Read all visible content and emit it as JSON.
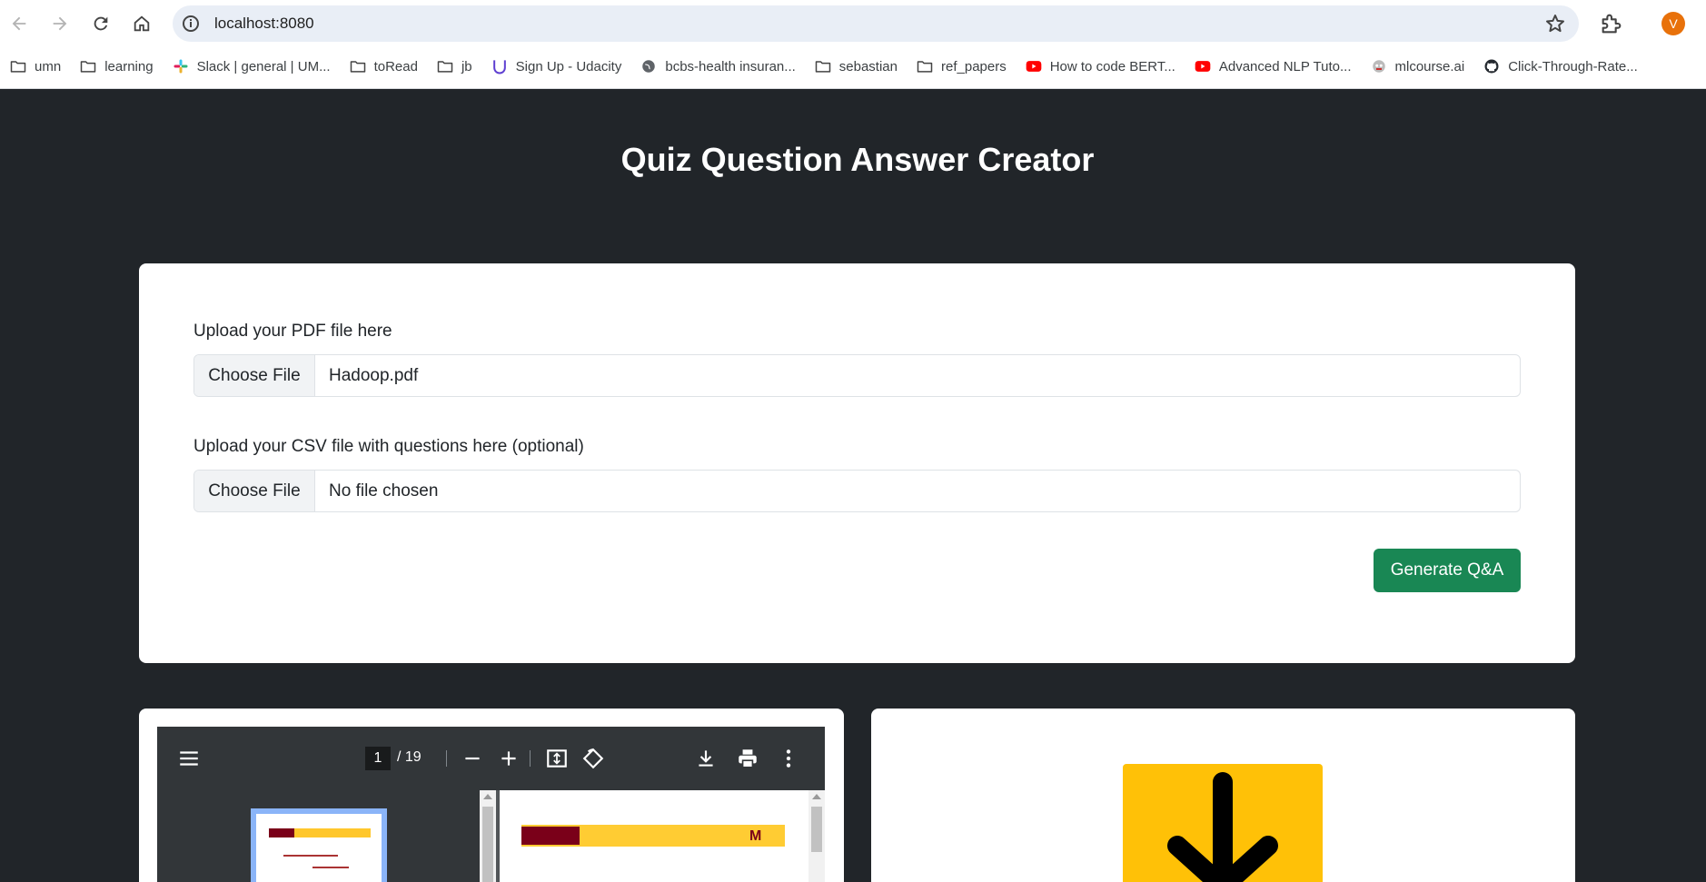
{
  "browser": {
    "url": "localhost:8080",
    "avatar_letter": "V",
    "bookmarks": [
      {
        "label": "umn",
        "icon": "folder-icon"
      },
      {
        "label": "learning",
        "icon": "folder-icon"
      },
      {
        "label": "Slack | general | UM...",
        "icon": "slack-icon"
      },
      {
        "label": "toRead",
        "icon": "folder-icon"
      },
      {
        "label": "jb",
        "icon": "folder-icon"
      },
      {
        "label": "Sign Up - Udacity",
        "icon": "udacity-icon"
      },
      {
        "label": "bcbs-health insuran...",
        "icon": "globe-icon"
      },
      {
        "label": "sebastian",
        "icon": "folder-icon"
      },
      {
        "label": "ref_papers",
        "icon": "folder-icon"
      },
      {
        "label": "How to code BERT...",
        "icon": "youtube-icon"
      },
      {
        "label": "Advanced NLP Tuto...",
        "icon": "youtube-icon"
      },
      {
        "label": "mlcourse.ai",
        "icon": "mlcourse-icon"
      },
      {
        "label": "Click-Through-Rate...",
        "icon": "github-icon"
      }
    ]
  },
  "page": {
    "title": "Quiz Question Answer Creator"
  },
  "form": {
    "pdf_label": "Upload your PDF file here",
    "pdf_button": "Choose File",
    "pdf_value": "Hadoop.pdf",
    "csv_label": "Upload your CSV file with questions here (optional)",
    "csv_button": "Choose File",
    "csv_value": "No file chosen",
    "submit_label": "Generate Q&A"
  },
  "pdf_viewer": {
    "current_page": "1",
    "total_pages": "/ 19"
  },
  "colors": {
    "background": "#212529",
    "submit": "#198754",
    "download_box": "#ffc107"
  }
}
